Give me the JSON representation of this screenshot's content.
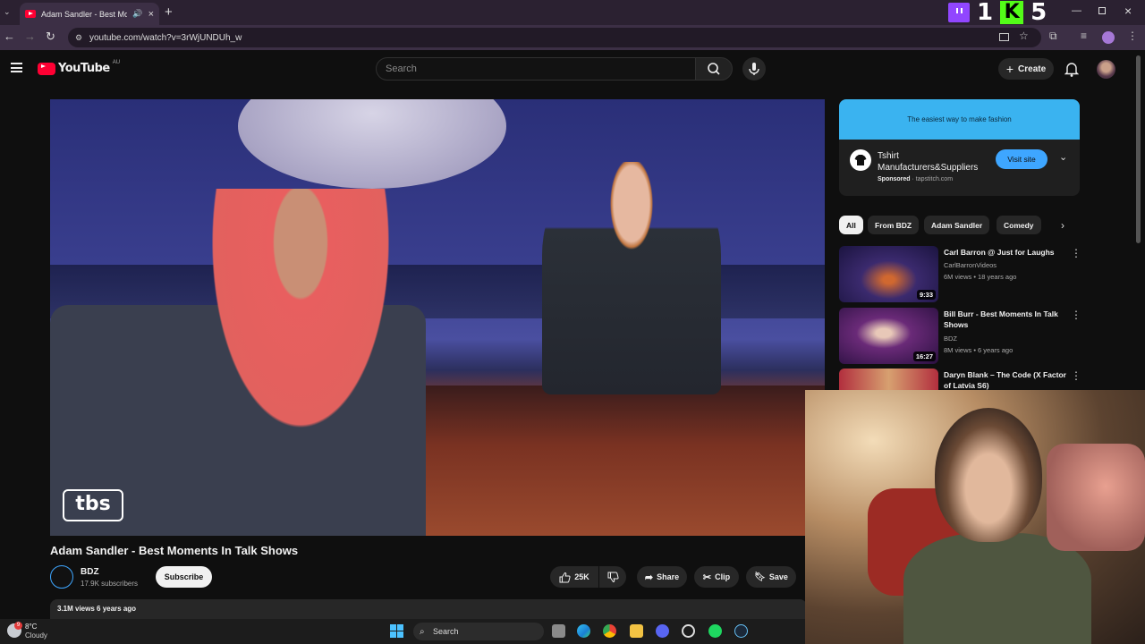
{
  "browser": {
    "tab_title": "Adam Sandler - Best Mome",
    "url": "youtube.com/watch?v=3rWjUNDUh_w"
  },
  "overlay": {
    "left_count": "1",
    "right_count": "5"
  },
  "youtube": {
    "logo_text": "YouTube",
    "region": "AU",
    "search_placeholder": "Search",
    "create_label": "Create"
  },
  "video": {
    "watermark": "tbs",
    "title": "Adam Sandler - Best Moments In Talk Shows",
    "channel_name": "BDZ",
    "subscribers": "17.9K subscribers",
    "subscribe_label": "Subscribe",
    "likes": "25K",
    "share_label": "Share",
    "clip_label": "Clip",
    "save_label": "Save",
    "views_line": "3.1M views  6 years ago"
  },
  "ad": {
    "banner_text": "The easiest way to make fashion",
    "title": "Tshirt Manufacturers&Suppliers",
    "sponsored": "Sponsored",
    "domain": "tapstitch.com",
    "cta": "Visit site"
  },
  "chips": [
    {
      "label": "All",
      "active": true
    },
    {
      "label": "From BDZ"
    },
    {
      "label": "Adam Sandler"
    },
    {
      "label": "Comedy"
    }
  ],
  "recommendations": [
    {
      "title": "Carl Barron @ Just for Laughs",
      "channel": "CarlBarronVideos",
      "stats": "6M views • 18 years ago",
      "duration": "9:33",
      "color": "#3b2a6e"
    },
    {
      "title": "Bill Burr - Best Moments In Talk Shows",
      "channel": "BDZ",
      "stats": "8M views • 6 years ago",
      "duration": "16:27",
      "color": "#6a2a78"
    },
    {
      "title": "Daryn Blank – The Code (X Factor of Latvia S6)",
      "channel": "",
      "stats": "",
      "duration": "",
      "color": "#b22f3e"
    }
  ],
  "taskbar": {
    "weather_temp": "8°C",
    "weather_condition": "Cloudy",
    "search_label": "Search",
    "notification_count": "9"
  }
}
